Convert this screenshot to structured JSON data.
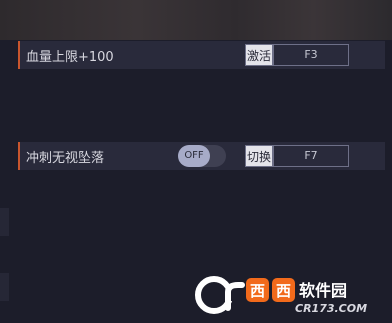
{
  "rows": [
    {
      "label": "血量上限+100",
      "hotkey_action": "激活",
      "hotkey_key": "F3"
    },
    {
      "label": "冲刺无视坠落",
      "toggle_state": "OFF",
      "hotkey_action": "切换",
      "hotkey_key": "F7"
    }
  ],
  "watermark": {
    "brand": "西西软件园",
    "domain": "CR173.COM"
  },
  "colors": {
    "accent": "#c9562e",
    "row_bg": "#292a3b",
    "page_bg": "#1c1d2a",
    "toggle_knob": "#a7abc8",
    "logo_orange": "#f26a1b"
  }
}
